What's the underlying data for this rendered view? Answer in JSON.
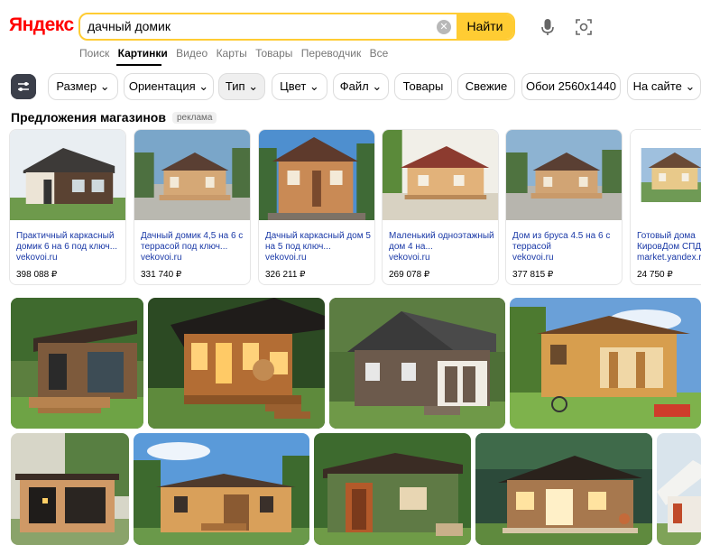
{
  "header": {
    "logo": "Яндекс",
    "search_query": "дачный домик",
    "find_label": "Найти",
    "services": [
      "Поиск",
      "Картинки",
      "Видео",
      "Карты",
      "Товары",
      "Переводчик",
      "Все"
    ],
    "active_service": "Картинки"
  },
  "filters": [
    "Размер",
    "Ориентация",
    "Тип",
    "Цвет",
    "Файл",
    "Товары",
    "Свежие",
    "Обои 2560x1440",
    "На сайте"
  ],
  "offers_section": {
    "title": "Предложения магазинов",
    "ad_label": "реклама",
    "items": [
      {
        "title": "Практичный каркасный домик 6 на 6 под ключ...",
        "shop": "vekovoi.ru",
        "price": "398 088 ₽"
      },
      {
        "title": "Дачный домик 4,5 на 6 с террасой под ключ...",
        "shop": "vekovoi.ru",
        "price": "331 740 ₽"
      },
      {
        "title": "Дачный каркасный дом 5 на 5 под ключ...",
        "shop": "vekovoi.ru",
        "price": "326 211 ₽"
      },
      {
        "title": "Маленький одноэтажный дом 4 на...",
        "shop": "vekovoi.ru",
        "price": "269 078 ₽"
      },
      {
        "title": "Дом из бруса 4.5 на 6 с террасой",
        "shop": "vekovoi.ru",
        "price": "377 815 ₽"
      },
      {
        "title": "Готовый дома КировДом СПД",
        "shop": "market.yandex.r",
        "price": "24 750 ₽"
      }
    ]
  },
  "colors": {
    "brand_red": "#ff0000",
    "search_yellow": "#ffcc33",
    "link_blue": "#1a39a7"
  }
}
